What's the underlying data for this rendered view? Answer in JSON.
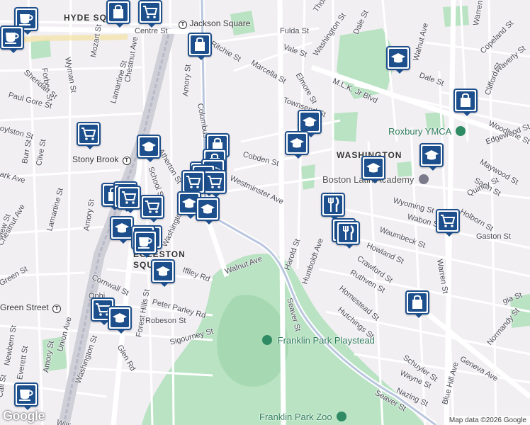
{
  "map": {
    "google_logo": "Google",
    "attribution": "Map data ©2026 Google",
    "neighborhoods": [
      {
        "id": "hyde-square",
        "text": "HYDE SQ"
      },
      {
        "id": "egleston-square-1",
        "text": "EGLESTON"
      },
      {
        "id": "egleston-square-2",
        "text": "SQUARE"
      },
      {
        "id": "washington",
        "text": "WASHINGTON"
      }
    ],
    "pois": [
      {
        "id": "jackson-square",
        "text": "Jackson Square",
        "icon": "transit-icon"
      },
      {
        "id": "stony-brook",
        "text": "Stony Brook",
        "icon": "transit-icon"
      },
      {
        "id": "green-street",
        "text": "Green Street",
        "icon": "transit-icon"
      },
      {
        "id": "roxbury-ymca",
        "text": "Roxbury YMCA",
        "icon": "park-icon"
      },
      {
        "id": "boston-latin-academy",
        "text": "Boston Latin Academy",
        "icon": "landmark-icon"
      },
      {
        "id": "franklin-park-playstead",
        "text": "Franklin Park Playstead",
        "icon": "park-icon"
      },
      {
        "id": "franklin-park-zoo",
        "text": "Franklin Park Zoo",
        "icon": "zoo-icon"
      }
    ],
    "streets": [
      {
        "id": "centre-st",
        "text": "Centre St"
      },
      {
        "id": "ritchie-st",
        "text": "Ritchie St"
      },
      {
        "id": "fulda-st",
        "text": "Fulda St"
      },
      {
        "id": "vale-st",
        "text": "Vale St"
      },
      {
        "id": "marcella-st",
        "text": "Marcella St"
      },
      {
        "id": "washington-st-n",
        "text": "Washington St"
      },
      {
        "id": "thornton-st",
        "text": "Thornton St"
      },
      {
        "id": "dale-st-n",
        "text": "Dale St"
      },
      {
        "id": "walnut-ave-n",
        "text": "Walnut Ave"
      },
      {
        "id": "warren-st-n",
        "text": "Warren St"
      },
      {
        "id": "copeland-st",
        "text": "Copeland St"
      },
      {
        "id": "waverly-st",
        "text": "Waverly St"
      },
      {
        "id": "dale-st",
        "text": "Dale St"
      },
      {
        "id": "clifford-st",
        "text": "Clifford St"
      },
      {
        "id": "mlk-blvd",
        "text": "M.L.K. Jr Blvd"
      },
      {
        "id": "elmore-st",
        "text": "Elmore St"
      },
      {
        "id": "townsend-st",
        "text": "Townsend St"
      },
      {
        "id": "woodbine-st",
        "text": "Woodbine St"
      },
      {
        "id": "edgewood-st",
        "text": "Edgewood St"
      },
      {
        "id": "maywood-st",
        "text": "Maywood St"
      },
      {
        "id": "savin-st",
        "text": "Savin St"
      },
      {
        "id": "quincy-st",
        "text": "Quincy St"
      },
      {
        "id": "holborn-st",
        "text": "Holborn St"
      },
      {
        "id": "wyoming-st",
        "text": "Wyoming St"
      },
      {
        "id": "wabon-st",
        "text": "Wabon St"
      },
      {
        "id": "waumbeck-st",
        "text": "Waumbeck St"
      },
      {
        "id": "gaston-st",
        "text": "Gaston St"
      },
      {
        "id": "howland-st",
        "text": "Howland St"
      },
      {
        "id": "crawford-st",
        "text": "Crawford St"
      },
      {
        "id": "ruthven-st",
        "text": "Ruthven St"
      },
      {
        "id": "homestead-st",
        "text": "Homestead St"
      },
      {
        "id": "hutchings-st",
        "text": "Hutchings St"
      },
      {
        "id": "warren-st",
        "text": "Warren St"
      },
      {
        "id": "cobden-st",
        "text": "Cobden St"
      },
      {
        "id": "westminster-ave",
        "text": "Westminster Ave"
      },
      {
        "id": "harold-st",
        "text": "Harold St"
      },
      {
        "id": "humboldt-ave",
        "text": "Humboldt Ave"
      },
      {
        "id": "seaver-st",
        "text": "Seaver St"
      },
      {
        "id": "seaver-st-2",
        "text": "Seaver St"
      },
      {
        "id": "walnut-ave",
        "text": "Walnut Ave"
      },
      {
        "id": "columbus-ave",
        "text": "Columbus"
      },
      {
        "id": "amory-st-n",
        "text": "Amory St"
      },
      {
        "id": "atherton-st",
        "text": "Atherton St"
      },
      {
        "id": "school-st",
        "text": "School St"
      },
      {
        "id": "washington-st-w",
        "text": "Washington"
      },
      {
        "id": "iffley-rd",
        "text": "Iffley Rd"
      },
      {
        "id": "peter-parley-rd",
        "text": "Peter Parley Rd"
      },
      {
        "id": "robeson-st",
        "text": "Robeson St"
      },
      {
        "id": "sigourney-st",
        "text": "Sigourney St"
      },
      {
        "id": "forest-hills-st",
        "text": "Forest Hills St"
      },
      {
        "id": "glen-rd",
        "text": "Glen Rd"
      },
      {
        "id": "cornwall-st",
        "text": "Cornwall St"
      },
      {
        "id": "washington-st-sw",
        "text": "Washington St"
      },
      {
        "id": "union-ave",
        "text": "Union Ave"
      },
      {
        "id": "amory-st-s",
        "text": "Amory St"
      },
      {
        "id": "everett-st",
        "text": "Everett St"
      },
      {
        "id": "newbern-st",
        "text": "Newbern St"
      },
      {
        "id": "green-st",
        "text": "Green St"
      },
      {
        "id": "chestnut-ave",
        "text": "Chestnut Ave"
      },
      {
        "id": "chestnut-ave-2",
        "text": "Chestnut Ave"
      },
      {
        "id": "lamartine-st",
        "text": "Lamartine St"
      },
      {
        "id": "lamartine-st-2",
        "text": "Lamartine St"
      },
      {
        "id": "amory-st",
        "text": "Amory St"
      },
      {
        "id": "mozart-st",
        "text": "Mozart St"
      },
      {
        "id": "wyman-st",
        "text": "Wyman St"
      },
      {
        "id": "forbes-st",
        "text": "Forbes St"
      },
      {
        "id": "sheridan-st",
        "text": "Sheridan St"
      },
      {
        "id": "paul-gore-st",
        "text": "Paul Gore St"
      },
      {
        "id": "boylston-st",
        "text": "oylston St"
      },
      {
        "id": "burr-st",
        "text": "Burr St"
      },
      {
        "id": "clive-st",
        "text": "Clive St"
      },
      {
        "id": "park-ave",
        "text": "ark Ave"
      },
      {
        "id": "view-st",
        "text": "view St"
      },
      {
        "id": "schuyler-st",
        "text": "Schuyler St"
      },
      {
        "id": "geneva-ave",
        "text": "Geneva Ave"
      },
      {
        "id": "blue-hill-ave",
        "text": "Blue Hill Ave"
      },
      {
        "id": "normandy-st",
        "text": "Normandy St"
      },
      {
        "id": "wayne-st",
        "text": "Wayne St"
      },
      {
        "id": "nazing-st",
        "text": "Nazing St"
      },
      {
        "id": "gia-st",
        "text": "gia St"
      },
      {
        "id": "opht",
        "text": "Ophi"
      },
      {
        "id": "call-st",
        "text": "Call St"
      },
      {
        "id": "williams",
        "text": "William"
      }
    ],
    "markers": [
      {
        "id": "m1",
        "icon": "cafe-icon"
      },
      {
        "id": "m2",
        "icon": "cafe-icon"
      },
      {
        "id": "m3",
        "icon": "shopping-bag-icon"
      },
      {
        "id": "m4",
        "icon": "shopping-cart-icon"
      },
      {
        "id": "m5",
        "icon": "shopping-bag-icon"
      },
      {
        "id": "m6",
        "icon": "shopping-cart-icon"
      },
      {
        "id": "m7",
        "icon": "shopping-bag-icon"
      },
      {
        "id": "m8",
        "icon": "school-icon"
      },
      {
        "id": "m9",
        "icon": "shopping-bag-icon"
      },
      {
        "id": "m10",
        "icon": "shopping-cart-icon"
      },
      {
        "id": "m11",
        "icon": "school-icon"
      },
      {
        "id": "m12",
        "icon": "school-icon"
      },
      {
        "id": "m13",
        "icon": "school-icon"
      },
      {
        "id": "m14",
        "icon": "shopping-cart-icon"
      },
      {
        "id": "m15",
        "icon": "shopping-cart-icon"
      },
      {
        "id": "m16",
        "icon": "shopping-cart-icon"
      },
      {
        "id": "m17",
        "icon": "school-icon"
      },
      {
        "id": "m18",
        "icon": "school-icon"
      },
      {
        "id": "m19",
        "icon": "shopping-bag-icon"
      },
      {
        "id": "m20",
        "icon": "restaurant-icon"
      },
      {
        "id": "m21",
        "icon": "restaurant-icon"
      },
      {
        "id": "m22",
        "icon": "shopping-cart-icon"
      },
      {
        "id": "m23",
        "icon": "school-icon"
      },
      {
        "id": "m24",
        "icon": "school-icon"
      },
      {
        "id": "m25",
        "icon": "school-icon"
      },
      {
        "id": "m26",
        "icon": "cafe-icon"
      },
      {
        "id": "m27",
        "icon": "school-icon"
      },
      {
        "id": "m28",
        "icon": "shopping-cart-icon"
      },
      {
        "id": "m29",
        "icon": "school-icon"
      },
      {
        "id": "m30",
        "icon": "restaurant-icon"
      },
      {
        "id": "m31",
        "icon": "restaurant-icon"
      },
      {
        "id": "m32",
        "icon": "restaurant-icon"
      },
      {
        "id": "m33",
        "icon": "school-icon"
      },
      {
        "id": "m34",
        "icon": "school-icon"
      },
      {
        "id": "m35",
        "icon": "school-icon"
      },
      {
        "id": "m36",
        "icon": "shopping-cart-icon"
      },
      {
        "id": "m37",
        "icon": "shopping-bag-icon"
      },
      {
        "id": "m38",
        "icon": "cafe-icon"
      }
    ],
    "colors": {
      "background": "#f2eff3",
      "park": "#b9e3c3",
      "park_dark": "#a6d9b2",
      "major_road": "#ffffff",
      "transit_line": "#b8b8c8",
      "marker_blue": "#1d4f8c",
      "poi_green": "#2e7d5b"
    }
  }
}
